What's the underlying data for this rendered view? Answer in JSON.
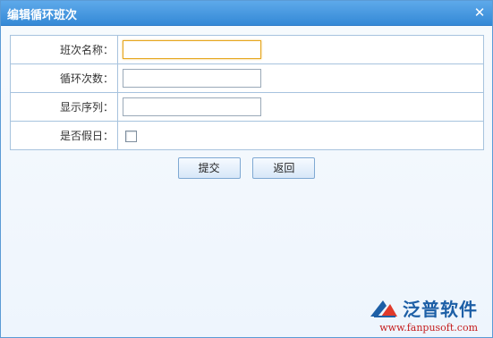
{
  "window": {
    "title": "编辑循环班次",
    "close_icon": "close-icon"
  },
  "form": {
    "fields": [
      {
        "label": "班次名称：",
        "value": "",
        "type": "text"
      },
      {
        "label": "循环次数：",
        "value": "",
        "type": "text"
      },
      {
        "label": "显示序列：",
        "value": "",
        "type": "text"
      },
      {
        "label": "是否假日：",
        "checked": false,
        "type": "checkbox"
      }
    ]
  },
  "buttons": {
    "submit": "提交",
    "back": "返回"
  },
  "brand": {
    "name": "泛普软件",
    "url": "www.fanpusoft.com"
  },
  "colors": {
    "titlebar": "#3c8fdb",
    "border": "#a7c3de",
    "brand": "#1d5fa6",
    "url": "#c51d1d"
  }
}
